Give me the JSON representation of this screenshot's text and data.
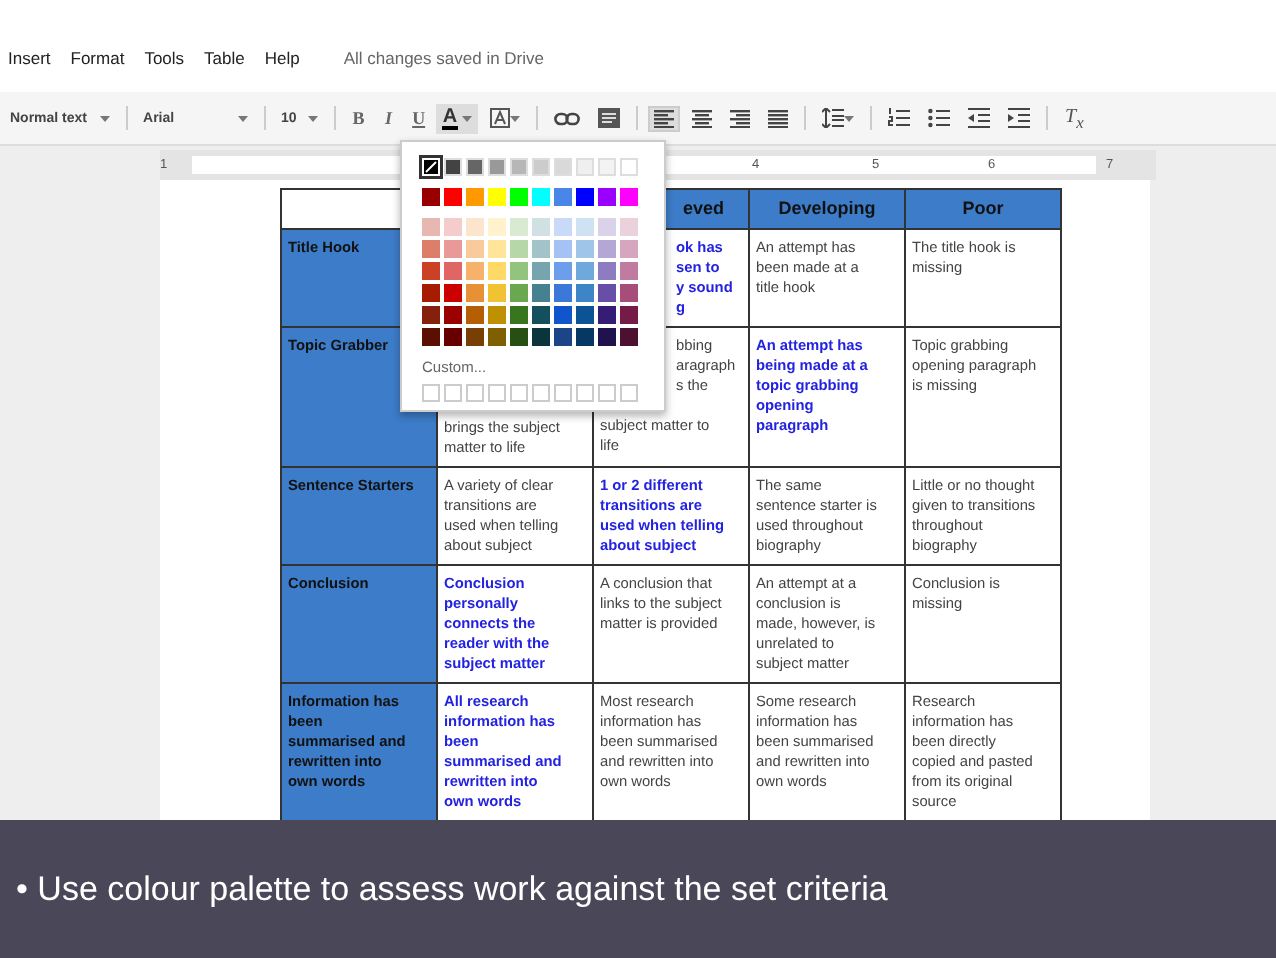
{
  "menu": [
    "Insert",
    "Format",
    "Tools",
    "Table",
    "Help"
  ],
  "save_status": "All changes saved in Drive",
  "toolbar": {
    "style": "Normal text",
    "font": "Arial",
    "size": "10",
    "format_buttons": [
      "B",
      "I",
      "U"
    ],
    "text_color": {
      "label": "A",
      "open": true
    },
    "align": [
      {
        "kind": "left",
        "selected": true
      },
      {
        "kind": "center",
        "selected": false
      },
      {
        "kind": "right",
        "selected": false
      },
      {
        "kind": "justify",
        "selected": false
      }
    ],
    "clear_formatting": "T$_{x}$"
  },
  "ruler": {
    "numbers": [
      "1",
      "4",
      "5",
      "6",
      "7"
    ]
  },
  "palette": {
    "grays": [
      {
        "color": "#000000",
        "selected": true
      },
      {
        "color": "#434343",
        "selected": false
      },
      {
        "color": "#666666",
        "selected": false
      },
      {
        "color": "#999999",
        "selected": false
      },
      {
        "color": "#b7b7b7",
        "selected": false
      },
      {
        "color": "#cccccc",
        "selected": false
      },
      {
        "color": "#d9d9d9",
        "selected": false
      },
      {
        "color": "#efefef",
        "selected": false
      },
      {
        "color": "#f3f3f3",
        "selected": false
      },
      {
        "color": "#ffffff",
        "selected": false
      }
    ],
    "brights": [
      {
        "color": "#980000"
      },
      {
        "color": "#ff0000"
      },
      {
        "color": "#ff9900"
      },
      {
        "color": "#ffff00"
      },
      {
        "color": "#00ff00"
      },
      {
        "color": "#00ffff"
      },
      {
        "color": "#4a86e8"
      },
      {
        "color": "#0000ff"
      },
      {
        "color": "#9900ff"
      },
      {
        "color": "#ff00ff"
      }
    ],
    "tints": [
      [
        {
          "color": "#e6b8af"
        },
        {
          "color": "#f4cccc"
        },
        {
          "color": "#fce5cd"
        },
        {
          "color": "#fff2cc"
        },
        {
          "color": "#d9ead3"
        },
        {
          "color": "#d0e0e3"
        },
        {
          "color": "#c9daf8"
        },
        {
          "color": "#cfe2f3"
        },
        {
          "color": "#d9d2e9"
        },
        {
          "color": "#ead1dc"
        }
      ],
      [
        {
          "color": "#dd7e6b"
        },
        {
          "color": "#ea9999"
        },
        {
          "color": "#f9cb9c"
        },
        {
          "color": "#ffe599"
        },
        {
          "color": "#b6d7a8"
        },
        {
          "color": "#a2c4c9"
        },
        {
          "color": "#a4c2f4"
        },
        {
          "color": "#9fc5e8"
        },
        {
          "color": "#b4a7d6"
        },
        {
          "color": "#d5a6bd"
        }
      ],
      [
        {
          "color": "#cc4125"
        },
        {
          "color": "#e06666"
        },
        {
          "color": "#f6b26b"
        },
        {
          "color": "#ffd966"
        },
        {
          "color": "#93c47d"
        },
        {
          "color": "#76a5af"
        },
        {
          "color": "#6d9eeb"
        },
        {
          "color": "#6fa8dc"
        },
        {
          "color": "#8e7cc3"
        },
        {
          "color": "#c27ba0"
        }
      ],
      [
        {
          "color": "#a61c00"
        },
        {
          "color": "#cc0000"
        },
        {
          "color": "#e69138"
        },
        {
          "color": "#f1c232"
        },
        {
          "color": "#6aa84f"
        },
        {
          "color": "#45818e"
        },
        {
          "color": "#3c78d8"
        },
        {
          "color": "#3d85c6"
        },
        {
          "color": "#674ea7"
        },
        {
          "color": "#a64d79"
        }
      ],
      [
        {
          "color": "#85200c"
        },
        {
          "color": "#990000"
        },
        {
          "color": "#b45f06"
        },
        {
          "color": "#bf9000"
        },
        {
          "color": "#38761d"
        },
        {
          "color": "#134f5c"
        },
        {
          "color": "#1155cc"
        },
        {
          "color": "#0b5394"
        },
        {
          "color": "#351c75"
        },
        {
          "color": "#741b47"
        }
      ],
      [
        {
          "color": "#5b0f00"
        },
        {
          "color": "#660000"
        },
        {
          "color": "#783f04"
        },
        {
          "color": "#7f6000"
        },
        {
          "color": "#274e13"
        },
        {
          "color": "#0c343d"
        },
        {
          "color": "#1c4587"
        },
        {
          "color": "#073763"
        },
        {
          "color": "#20124d"
        },
        {
          "color": "#4c1130"
        }
      ]
    ],
    "custom_label": "Custom..."
  },
  "table": {
    "headers": [
      "eved",
      "Developing",
      "Poor"
    ],
    "rows": [
      {
        "label": "Title Hook",
        "cells": [
          null,
          {
            "lines_beside": [
              "ok has",
              "sen to",
              "y sound",
              "g"
            ],
            "highlighted": true
          },
          {
            "text": "An attempt has\nbeen made at a\ntitle hook",
            "highlighted": false
          },
          {
            "text": "The title hook is\nmissing",
            "highlighted": false
          }
        ]
      },
      {
        "label": "Topic Grabber",
        "cells": [
          {
            "lines_below": [
              "brings the subject",
              "matter to life"
            ],
            "highlighted": false
          },
          {
            "lines_beside": [
              "bbing",
              "aragraph",
              "s the"
            ],
            "lines_below": [
              "subject matter to",
              "life"
            ],
            "highlighted": false
          },
          {
            "text": "An attempt has\nbeing made at a\ntopic grabbing\nopening\nparagraph",
            "highlighted": true
          },
          {
            "text": "Topic grabbing\nopening paragraph\nis missing",
            "highlighted": false
          }
        ]
      },
      {
        "label": "Sentence Starters",
        "cells": [
          {
            "text": "A variety of clear\ntransitions are\nused when telling\nabout subject",
            "highlighted": false
          },
          {
            "text": "1 or 2 different\ntransitions are\nused when telling\nabout subject",
            "highlighted": true
          },
          {
            "text": "The same\nsentence starter is\nused throughout\nbiography",
            "highlighted": false
          },
          {
            "text": "Little or no thought\ngiven to transitions\nthroughout\nbiography",
            "highlighted": false
          }
        ]
      },
      {
        "label": "Conclusion",
        "cells": [
          {
            "text": "Conclusion\npersonally\nconnects the\nreader with the\nsubject matter",
            "highlighted": true
          },
          {
            "text": "A conclusion that\nlinks to the subject\nmatter is provided",
            "highlighted": false
          },
          {
            "text": "An attempt at a\nconclusion is\nmade, however, is\nunrelated to\nsubject matter",
            "highlighted": false
          },
          {
            "text": "Conclusion is\nmissing",
            "highlighted": false
          }
        ]
      },
      {
        "label": "Information has\nbeen\nsummarised and\nrewritten into\nown words",
        "cells": [
          {
            "text": "All research\ninformation has\nbeen\nsummarised and\nrewritten into\nown words",
            "highlighted": true
          },
          {
            "text": "Most research\ninformation has\nbeen summarised\nand rewritten into\nown words",
            "highlighted": false
          },
          {
            "text": "Some research\ninformation has\nbeen summarised\nand rewritten into\nown words",
            "highlighted": false
          },
          {
            "text": "Research\ninformation has\nbeen directly\ncopied and pasted\nfrom its original\nsource",
            "highlighted": false
          }
        ]
      }
    ]
  },
  "caption": "• Use colour palette to assess work against the set criteria"
}
